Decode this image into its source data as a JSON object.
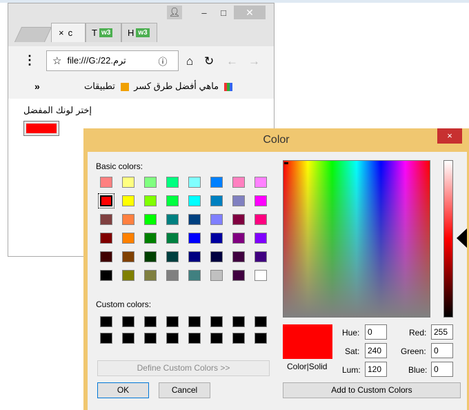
{
  "browser": {
    "tabs": [
      {
        "label": "c",
        "close": "×"
      },
      {
        "label": "T",
        "badge": "w3"
      },
      {
        "label": "H",
        "badge": "w3"
      }
    ],
    "url": "file:///G:/22.ترم",
    "bookmarks_more": "»",
    "bookmark_1": "ماهي أفضل طرق كسر",
    "bookmark_apps": "تطبيقات",
    "page_label": "إختر لونك المفضل",
    "input_color": "#ff0000"
  },
  "dialog": {
    "title": "Color",
    "close": "×",
    "basic_colors_label": "Basic colors:",
    "custom_colors_label": "Custom colors:",
    "define_custom_button": "Define Custom Colors >>",
    "ok_button": "OK",
    "cancel_button": "Cancel",
    "color_solid_label": "Color|Solid",
    "add_custom_button": "Add to Custom Colors",
    "hue_label": "Hue:",
    "hue": "0",
    "sat_label": "Sat:",
    "sat": "240",
    "lum_label": "Lum:",
    "lum": "120",
    "red_label": "Red:",
    "red": "255",
    "green_label": "Green:",
    "green": "0",
    "blue_label": "Blue:",
    "blue": "0",
    "basic_colors": [
      [
        "#ff8080",
        "#ffff80",
        "#80ff80",
        "#00ff80",
        "#80ffff",
        "#0080ff",
        "#ff80c0",
        "#ff80ff"
      ],
      [
        "#ff0000",
        "#ffff00",
        "#80ff00",
        "#00ff40",
        "#00ffff",
        "#0080c0",
        "#8080c0",
        "#ff00ff"
      ],
      [
        "#804040",
        "#ff8040",
        "#00ff00",
        "#008080",
        "#004080",
        "#8080ff",
        "#800040",
        "#ff0080"
      ],
      [
        "#800000",
        "#ff8000",
        "#008000",
        "#008040",
        "#0000ff",
        "#0000a0",
        "#800080",
        "#8000ff"
      ],
      [
        "#400000",
        "#804000",
        "#004000",
        "#004040",
        "#000080",
        "#000040",
        "#400040",
        "#400080"
      ],
      [
        "#000000",
        "#808000",
        "#808040",
        "#808080",
        "#408080",
        "#c0c0c0",
        "#400040",
        "#ffffff"
      ]
    ],
    "selected_swatch": [
      1,
      0
    ],
    "custom_colors": [
      "#000000",
      "#000000",
      "#000000",
      "#000000",
      "#000000",
      "#000000",
      "#000000",
      "#000000",
      "#000000",
      "#000000",
      "#000000",
      "#000000",
      "#000000",
      "#000000",
      "#000000",
      "#000000"
    ],
    "current_color": "#ff0000"
  }
}
